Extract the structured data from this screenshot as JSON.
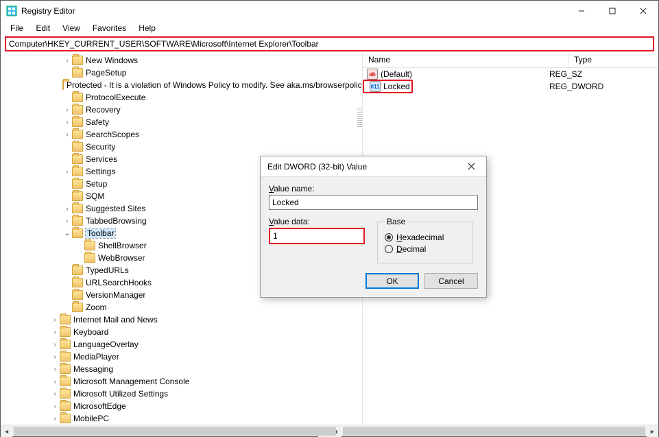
{
  "window": {
    "title": "Registry Editor"
  },
  "menu": {
    "file": "File",
    "edit": "Edit",
    "view": "View",
    "favorites": "Favorites",
    "help": "Help"
  },
  "address": {
    "path": "Computer\\HKEY_CURRENT_USER\\SOFTWARE\\Microsoft\\Internet Explorer\\Toolbar"
  },
  "tree": {
    "items": [
      {
        "indent": 5,
        "expander": ">",
        "label": "New Windows"
      },
      {
        "indent": 5,
        "expander": "",
        "label": "PageSetup"
      },
      {
        "indent": 5,
        "expander": "",
        "label": "Protected - It is a violation of Windows Policy to modify. See aka.ms/browserpolicy"
      },
      {
        "indent": 5,
        "expander": "",
        "label": "ProtocolExecute"
      },
      {
        "indent": 5,
        "expander": ">",
        "label": "Recovery"
      },
      {
        "indent": 5,
        "expander": ">",
        "label": "Safety"
      },
      {
        "indent": 5,
        "expander": ">",
        "label": "SearchScopes"
      },
      {
        "indent": 5,
        "expander": "",
        "label": "Security"
      },
      {
        "indent": 5,
        "expander": "",
        "label": "Services"
      },
      {
        "indent": 5,
        "expander": ">",
        "label": "Settings"
      },
      {
        "indent": 5,
        "expander": "",
        "label": "Setup"
      },
      {
        "indent": 5,
        "expander": "",
        "label": "SQM"
      },
      {
        "indent": 5,
        "expander": ">",
        "label": "Suggested Sites"
      },
      {
        "indent": 5,
        "expander": ">",
        "label": "TabbedBrowsing"
      },
      {
        "indent": 5,
        "expander": "v",
        "label": "Toolbar",
        "selected": true
      },
      {
        "indent": 6,
        "expander": "",
        "label": "ShellBrowser"
      },
      {
        "indent": 6,
        "expander": "",
        "label": "WebBrowser"
      },
      {
        "indent": 5,
        "expander": "",
        "label": "TypedURLs"
      },
      {
        "indent": 5,
        "expander": "",
        "label": "URLSearchHooks"
      },
      {
        "indent": 5,
        "expander": "",
        "label": "VersionManager"
      },
      {
        "indent": 5,
        "expander": "",
        "label": "Zoom"
      },
      {
        "indent": 4,
        "expander": ">",
        "label": "Internet Mail and News"
      },
      {
        "indent": 4,
        "expander": ">",
        "label": "Keyboard"
      },
      {
        "indent": 4,
        "expander": ">",
        "label": "LanguageOverlay"
      },
      {
        "indent": 4,
        "expander": ">",
        "label": "MediaPlayer"
      },
      {
        "indent": 4,
        "expander": ">",
        "label": "Messaging"
      },
      {
        "indent": 4,
        "expander": ">",
        "label": "Microsoft Management Console"
      },
      {
        "indent": 4,
        "expander": ">",
        "label": "Microsoft Utilized Settings"
      },
      {
        "indent": 4,
        "expander": ">",
        "label": "MicrosoftEdge"
      },
      {
        "indent": 4,
        "expander": ">",
        "label": "MobilePC"
      }
    ]
  },
  "list": {
    "header": {
      "name": "Name",
      "type": "Type"
    },
    "rows": [
      {
        "icon": "sz",
        "iconText": "ab",
        "name": "(Default)",
        "type": "REG_SZ",
        "highlight": false
      },
      {
        "icon": "dw",
        "iconText": "011",
        "name": "Locked",
        "type": "REG_DWORD",
        "highlight": true
      }
    ]
  },
  "dialog": {
    "title": "Edit DWORD (32-bit) Value",
    "valueNameLabel": "Value name:",
    "valueName": "Locked",
    "valueDataLabel": "Value data:",
    "valueData": "1",
    "baseLabel": "Base",
    "hex": "Hexadecimal",
    "dec": "Decimal",
    "ok": "OK",
    "cancel": "Cancel"
  }
}
